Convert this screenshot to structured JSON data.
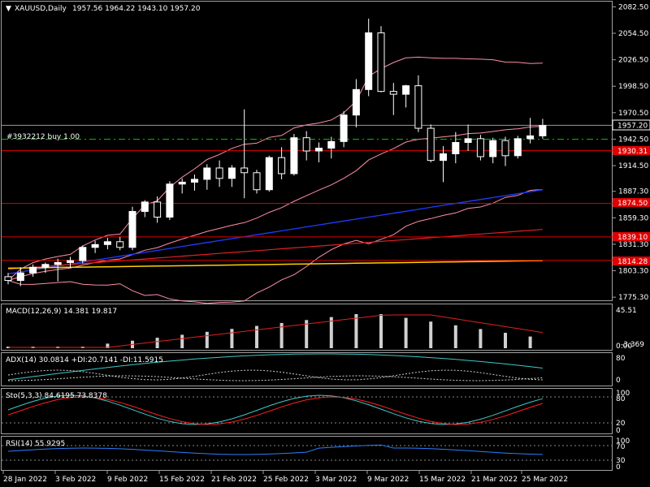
{
  "main": {
    "title_arrow": "▼",
    "title": "XAUUSD,Daily",
    "ohlc": "1957.56 1964.22 1943.10 1957.20",
    "order_label": "#3932212 buy 1.00",
    "price_ticks": [
      "2082.50",
      "2054.50",
      "2026.50",
      "1998.50",
      "1970.50",
      "1942.50",
      "1914.50",
      "1887.30",
      "1859.30",
      "1831.30",
      "1803.30",
      "1775.30"
    ],
    "current_price": "1957.20",
    "level_labels": [
      {
        "text": "1930.31",
        "color": "#e00000"
      },
      {
        "text": "1874.50",
        "color": "#e00000"
      },
      {
        "text": "1839.10",
        "color": "#e00000"
      },
      {
        "text": "1814.28",
        "color": "#e00000"
      }
    ]
  },
  "macd": {
    "label": "MACD(12,26,9) 14.381 19.817",
    "ticks": [
      "45.51",
      "0.00",
      "-3.369"
    ]
  },
  "adx": {
    "label": "ADX(14) 30.0814 +DI:20.7141 -DI:11.5915",
    "ticks": [
      "80",
      "0"
    ]
  },
  "stoch": {
    "label": "Sto(5,3,3) 84.6195 73.8378",
    "ticks": [
      "100",
      "80",
      "20",
      "0"
    ]
  },
  "rsi": {
    "label": "RSI(14) 55.9295",
    "ticks": [
      "100",
      "70",
      "30",
      "0"
    ]
  },
  "dates": [
    "28 Jan 2022",
    "3 Feb 2022",
    "9 Feb 2022",
    "15 Feb 2022",
    "21 Feb 2022",
    "25 Feb 2022",
    "3 Mar 2022",
    "9 Mar 2022",
    "15 Mar 2022",
    "21 Mar 2022",
    "25 Mar 2022"
  ],
  "colors": {
    "background": "#000000",
    "candle": "#ffffff",
    "level_line": "#e00000",
    "bollinger": "#ff8fa8",
    "ma_blue": "#1e3cff",
    "ma_red": "#e02020",
    "ma_yellow": "#ffd000",
    "order_line": "#00c000",
    "adx_main": "#3fc8c8",
    "stoch_main": "#3fc8c8",
    "stoch_signal": "#ff2020",
    "rsi_line": "#2a7fff"
  },
  "chart_data": {
    "type": "candlestick",
    "candles": [
      [
        1797,
        1801,
        1789,
        1793
      ],
      [
        1793,
        1807,
        1787,
        1801
      ],
      [
        1801,
        1810,
        1797,
        1807
      ],
      [
        1807,
        1812,
        1801,
        1810
      ],
      [
        1810,
        1816,
        1792,
        1812
      ],
      [
        1812,
        1818,
        1806,
        1814
      ],
      [
        1814,
        1830,
        1811,
        1828
      ],
      [
        1828,
        1835,
        1822,
        1831
      ],
      [
        1831,
        1838,
        1826,
        1834
      ],
      [
        1834,
        1839,
        1825,
        1828
      ],
      [
        1828,
        1871,
        1825,
        1866
      ],
      [
        1866,
        1878,
        1860,
        1876
      ],
      [
        1876,
        1882,
        1854,
        1860
      ],
      [
        1860,
        1898,
        1857,
        1895
      ],
      [
        1895,
        1901,
        1885,
        1897
      ],
      [
        1897,
        1905,
        1888,
        1900
      ],
      [
        1900,
        1916,
        1889,
        1912
      ],
      [
        1912,
        1920,
        1892,
        1901
      ],
      [
        1901,
        1915,
        1892,
        1912
      ],
      [
        1912,
        1974,
        1880,
        1907
      ],
      [
        1907,
        1910,
        1885,
        1889
      ],
      [
        1889,
        1925,
        1887,
        1923
      ],
      [
        1923,
        1934,
        1900,
        1906
      ],
      [
        1906,
        1948,
        1904,
        1944
      ],
      [
        1944,
        1951,
        1920,
        1930
      ],
      [
        1930,
        1939,
        1918,
        1933
      ],
      [
        1933,
        1945,
        1922,
        1940
      ],
      [
        1940,
        1972,
        1934,
        1968
      ],
      [
        1968,
        2006,
        1955,
        1995
      ],
      [
        1995,
        2070,
        1988,
        2055
      ],
      [
        2055,
        2062,
        1992,
        1993
      ],
      [
        1993,
        2002,
        1968,
        1990
      ],
      [
        1990,
        2000,
        1976,
        1999
      ],
      [
        1999,
        2010,
        1950,
        1954
      ],
      [
        1954,
        1958,
        1918,
        1920
      ],
      [
        1920,
        1935,
        1897,
        1927
      ],
      [
        1927,
        1950,
        1917,
        1939
      ],
      [
        1939,
        1958,
        1930,
        1943
      ],
      [
        1943,
        1947,
        1920,
        1924
      ],
      [
        1924,
        1944,
        1917,
        1941
      ],
      [
        1941,
        1945,
        1914,
        1925
      ],
      [
        1925,
        1946,
        1922,
        1943
      ],
      [
        1943,
        1965,
        1938,
        1946
      ],
      [
        1946,
        1964,
        1943,
        1957
      ]
    ],
    "horizontal_levels": [
      1957.2,
      1930.31,
      1874.5,
      1839.1,
      1814.28
    ],
    "order_level": 1942.5,
    "y_range": [
      1772,
      2088
    ]
  }
}
